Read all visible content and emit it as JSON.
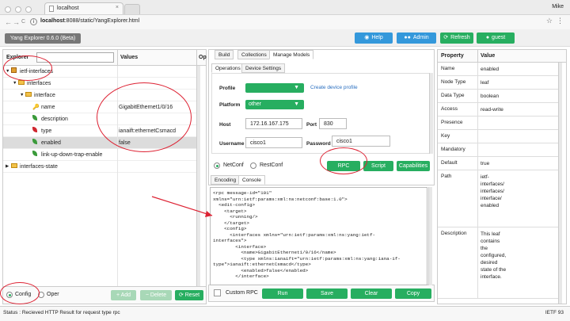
{
  "browser": {
    "tab_title": "localhost",
    "user": "Mike",
    "url_host": "localhost",
    "url_rest": ":8088/static/YangExplorer.html",
    "back": "←",
    "forward": "→",
    "reload": "C"
  },
  "app": {
    "version": "Yang Explorer 0.6.0 (Beta)",
    "help": "Help",
    "admin": "Admin",
    "refresh": "Refresh",
    "guest": "guest"
  },
  "explorer": {
    "header_explorer": "Explorer",
    "header_values": "Values",
    "header_op": "Op",
    "search_value": "",
    "rows": [
      {
        "label": "ietf-interfaces",
        "value": "",
        "indent": 0,
        "toggle": "▼",
        "icon": "module",
        "selected": false
      },
      {
        "label": "interfaces",
        "value": "",
        "indent": 1,
        "toggle": "▼",
        "icon": "folder",
        "selected": false
      },
      {
        "label": "interface",
        "value": "",
        "indent": 2,
        "toggle": "▼",
        "icon": "folder",
        "selected": false
      },
      {
        "label": "name",
        "value": "GigabitEthernet1/0/16",
        "indent": 3,
        "toggle": "",
        "icon": "key",
        "selected": false
      },
      {
        "label": "description",
        "value": "",
        "indent": 3,
        "toggle": "",
        "icon": "leaf-green",
        "selected": false
      },
      {
        "label": "type",
        "value": "ianaift:ethernetCsmacd",
        "indent": 3,
        "toggle": "",
        "icon": "leaf-red",
        "selected": false
      },
      {
        "label": "enabled",
        "value": "false",
        "indent": 3,
        "toggle": "",
        "icon": "leaf-green",
        "selected": true
      },
      {
        "label": "link-up-down-trap-enable",
        "value": "",
        "indent": 3,
        "toggle": "",
        "icon": "leaf-green",
        "selected": false
      },
      {
        "label": "interfaces-state",
        "value": "",
        "indent": 0,
        "toggle": "▶",
        "icon": "folder",
        "selected": false
      }
    ],
    "mode_config": "Config",
    "mode_oper": "Oper",
    "add": "+ Add",
    "delete": "− Delete",
    "reset": "Reset"
  },
  "middle": {
    "tabs": [
      "Build",
      "Collections",
      "Manage Models"
    ],
    "subtabs": [
      "Operations",
      "Device Settings"
    ],
    "profile_label": "Profile",
    "profile_value": "",
    "create_profile": "Create device profile",
    "platform_label": "Platform",
    "platform_value": "other",
    "host_label": "Host",
    "host_value": "172.16.167.175",
    "port_label": "Port",
    "port_value": "830",
    "username_label": "Username",
    "username_value": "cisco1",
    "password_label": "Password",
    "password_value": "cisco1",
    "netconf": "NetConf",
    "restconf": "RestConf",
    "rpc": "RPC",
    "script": "Script",
    "capabilities": "Capabilities",
    "console_tabs": [
      "Encoding",
      "Console"
    ],
    "console_text": "<rpc message-id=\"101\"\nxmlns=\"urn:ietf:params:xml:ns:netconf:base:1.0\">\n  <edit-config>\n    <target>\n      <running/>\n    </target>\n    <config>\n      <interfaces xmlns=\"urn:ietf:params:xml:ns:yang:ietf-\ninterfaces\">\n        <interface>\n          <name>GigabitEthernet1/0/16</name>\n          <type xmlns:ianaift=\"urn:ietf:params:xml:ns:yang:iana-if-\ntype\">ianaift:ethernetCsmacd</type>\n          <enabled>false</enabled>\n        </interface>",
    "custom_rpc": "Custom RPC",
    "run": "Run",
    "save": "Save",
    "clear": "Clear",
    "copy": "Copy"
  },
  "properties": {
    "header_property": "Property",
    "header_value": "Value",
    "rows": [
      {
        "k": "Name",
        "v": "enabled",
        "h": 17
      },
      {
        "k": "Node Type",
        "v": "leaf",
        "h": 17
      },
      {
        "k": "Data Type",
        "v": "boolean",
        "h": 17
      },
      {
        "k": "Access",
        "v": "read-write",
        "h": 17
      },
      {
        "k": "Presence",
        "v": "",
        "h": 17
      },
      {
        "k": "Key",
        "v": "",
        "h": 17
      },
      {
        "k": "Mandatory",
        "v": "",
        "h": 17
      },
      {
        "k": "Default",
        "v": "true",
        "h": 17
      },
      {
        "k": "Path",
        "v": "ietf-\ninterfaces/\ninterfaces/\ninterface/\nenabled",
        "h": 72
      },
      {
        "k": "Description",
        "v": "This leaf\ncontains\nthe\nconfigured,\ndesired\nstate of the\ninterface.",
        "h": 90
      }
    ]
  },
  "status": {
    "text": "Status : Recieved HTTP Result for request type rpc",
    "right": "IETF 93"
  },
  "colors": {
    "green": "#27ae60",
    "blue": "#3498db",
    "annotation": "#dd2233"
  }
}
